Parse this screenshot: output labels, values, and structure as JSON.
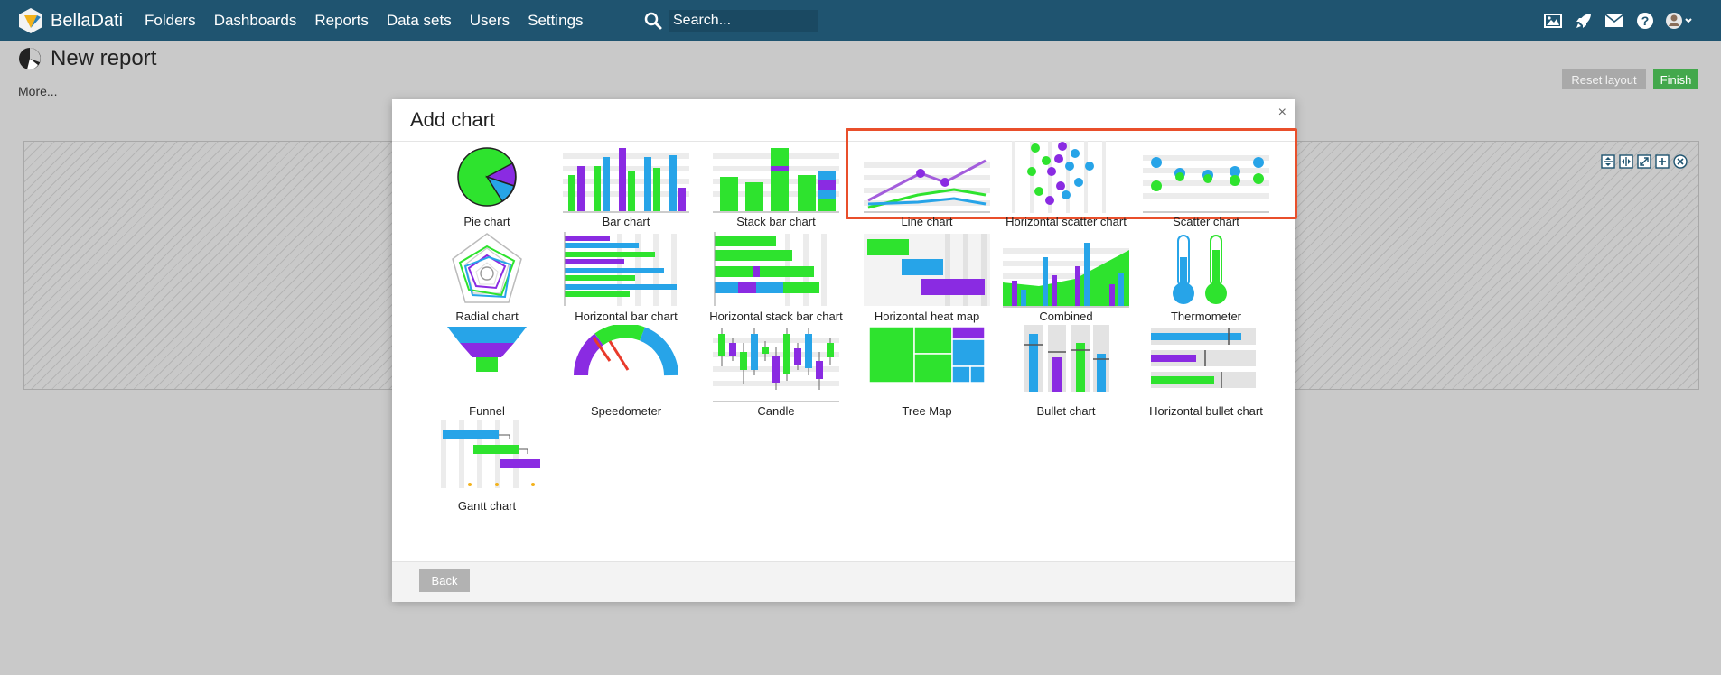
{
  "brand": {
    "name": "BellaDati"
  },
  "nav": {
    "items": [
      {
        "label": "Folders"
      },
      {
        "label": "Dashboards"
      },
      {
        "label": "Reports"
      },
      {
        "label": "Data sets"
      },
      {
        "label": "Users"
      },
      {
        "label": "Settings"
      }
    ]
  },
  "search": {
    "placeholder": "Search..."
  },
  "top_icons": [
    "image-icon",
    "rocket-icon",
    "mail-icon",
    "help-icon",
    "user-avatar-icon"
  ],
  "page": {
    "title": "New report",
    "more_link": "More...",
    "reset_label": "Reset layout",
    "finish_label": "Finish"
  },
  "modal": {
    "title": "Add chart",
    "close_glyph": "×",
    "back_label": "Back",
    "chart_types": [
      {
        "label": "Pie chart"
      },
      {
        "label": "Bar chart"
      },
      {
        "label": "Stack bar chart"
      },
      {
        "label": "Line chart"
      },
      {
        "label": "Horizontal scatter chart"
      },
      {
        "label": "Scatter chart"
      },
      {
        "label": "Radial chart"
      },
      {
        "label": "Horizontal bar chart"
      },
      {
        "label": "Horizontal stack bar chart"
      },
      {
        "label": "Horizontal heat map"
      },
      {
        "label": "Combined"
      },
      {
        "label": "Thermometer"
      },
      {
        "label": "Funnel"
      },
      {
        "label": "Speedometer"
      },
      {
        "label": "Candle"
      },
      {
        "label": "Tree Map"
      },
      {
        "label": "Bullet chart"
      },
      {
        "label": "Horizontal bullet chart"
      },
      {
        "label": "Gantt chart"
      }
    ]
  },
  "colors": {
    "topbar": "#1f5470",
    "green": "#2ee32e",
    "purple": "#8a2be2",
    "blue": "#27a4e8",
    "highlight": "#e94f2b",
    "finish": "#43a84c"
  }
}
